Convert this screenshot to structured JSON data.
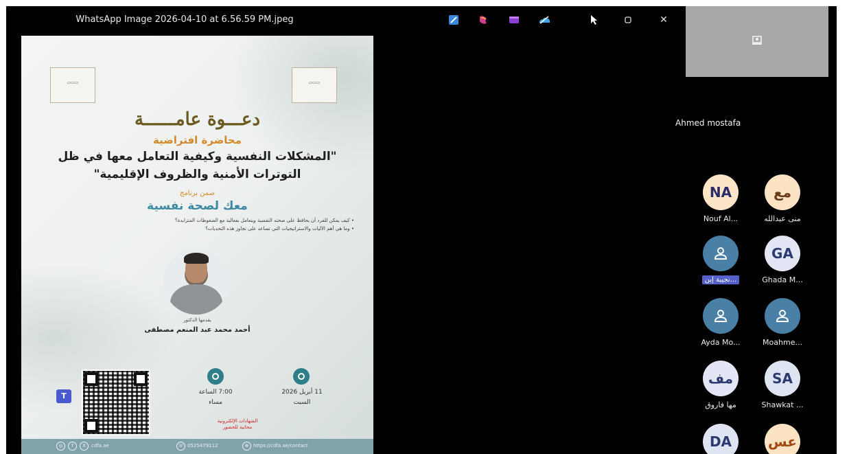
{
  "viewer": {
    "title": "WhatsApp Image 2026-04-10 at 6.56.59 PM.jpeg",
    "toolbar_icons": [
      "paint-app-icon",
      "copilot-icon",
      "clipchamp-icon",
      "onedrive-icon",
      "pointer-icon",
      "restore-icon",
      "close-icon"
    ],
    "close_glyph": "✕"
  },
  "poster": {
    "invite": "دعـــوة عامــــــة",
    "lecture_type": "محاضرة افتراضية",
    "topic_line1": "\"المشكلات النفسية وكيفية التعامل معها في ظل",
    "topic_line2": "التوترات الأمنية والظروف الإقليمية\"",
    "within": "ضمن برنامج",
    "program": "معك لصحة نفسية",
    "bullet1": "• كيف يمكن للفرد أن يحافظ على صحته النفسية ويتعامل بفعالية مع الضغوطات المتزايدة؟",
    "bullet2": "• وما هي أهم الآليات والاستراتيجيات التي تساعد على تجاوز هذه التحديات؟",
    "presenter_label": "يقدمها الدكتور",
    "presenter_name": "أحمد محمد عبد المنعم مصطفى",
    "date": "11 أبريل 2026",
    "day": "السبت",
    "time": "7:00 الساعة",
    "period": "مساء",
    "free_line1": "الشهادات الإلكترونية",
    "free_line2": "مجانية للحضور",
    "footer_site": "cdfa.ae",
    "footer_phone": "0525479112",
    "footer_link": "https://cdfa.ae/contact"
  },
  "panel": {
    "pinned_name": "Ahmed mostafa",
    "participants": [
      {
        "initials": "NA",
        "name": "Nouf Al...",
        "bg": "#fde6c8",
        "fg": "#2b2b6a"
      },
      {
        "initials": "مع",
        "name": "منى عبدالله",
        "bg": "#fbe3c4",
        "fg": "#6a3a1a"
      },
      {
        "initials": "",
        "name": "نجيبة إبن...",
        "bg": "#4a7fa6",
        "fg": "#ffffff",
        "icon": "person-icon",
        "badge": true
      },
      {
        "initials": "GA",
        "name": "Ghada M...",
        "bg": "#e3e6f5",
        "fg": "#2c3a70"
      },
      {
        "initials": "",
        "name": "Ayda Mo...",
        "bg": "#4a7fa6",
        "fg": "#ffffff",
        "icon": "person-icon"
      },
      {
        "initials": "",
        "name": "Moahme...",
        "bg": "#4a7fa6",
        "fg": "#ffffff",
        "icon": "person-icon"
      },
      {
        "initials": "مف",
        "name": "مها فاروق",
        "bg": "#e3e6f5",
        "fg": "#2c3a70"
      },
      {
        "initials": "SA",
        "name": "Shawkat ...",
        "bg": "#dfe4f3",
        "fg": "#2c3a70"
      },
      {
        "initials": "DA",
        "name": "",
        "bg": "#dfe4f3",
        "fg": "#2c3a70"
      },
      {
        "initials": "عس",
        "name": "",
        "bg": "#fbe3c4",
        "fg": "#a04a10"
      }
    ]
  }
}
